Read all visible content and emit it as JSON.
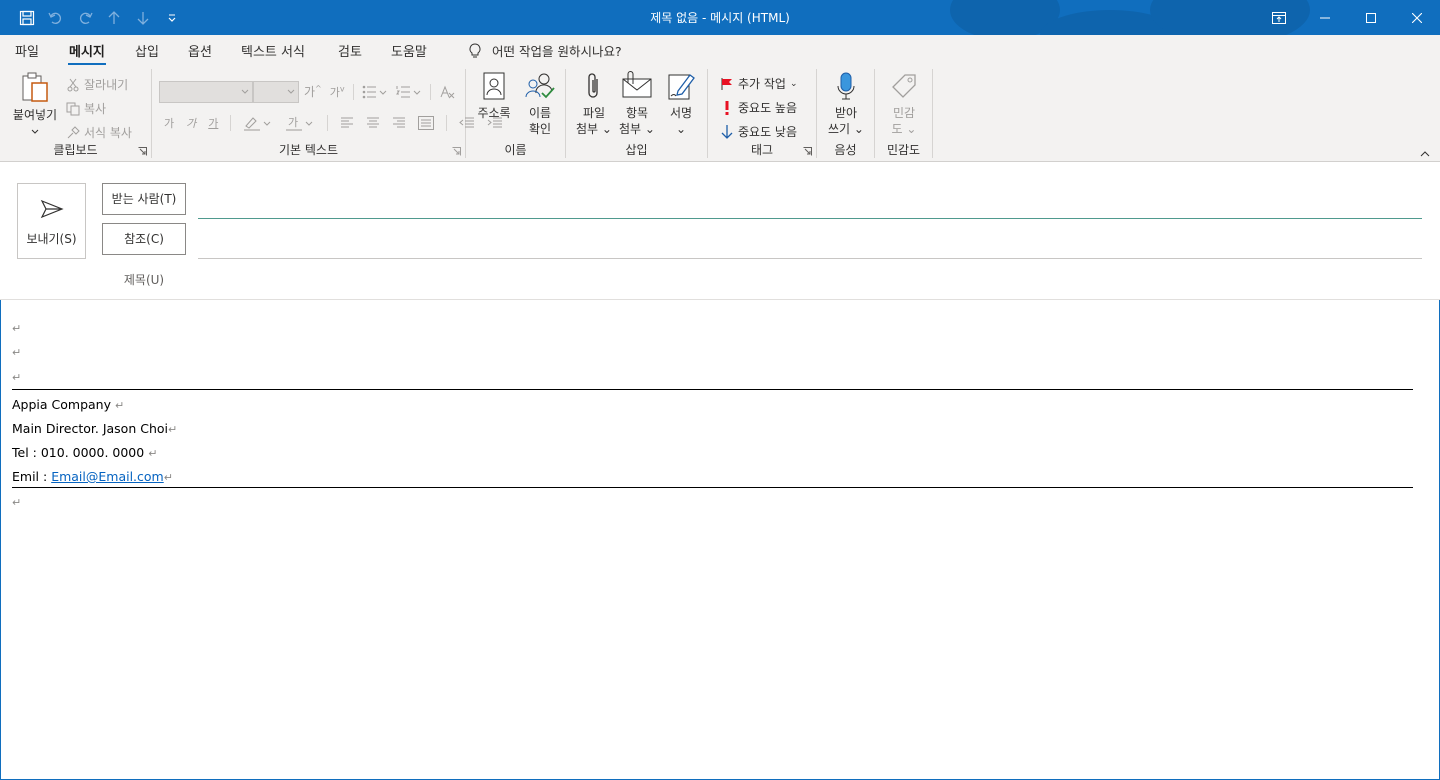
{
  "window": {
    "title": "제목 없음  -  메시지 (HTML)"
  },
  "menu": {
    "tabs": [
      "파일",
      "메시지",
      "삽입",
      "옵션",
      "텍스트 서식",
      "검토",
      "도움말"
    ],
    "active_tab": "메시지",
    "tell_me": "어떤 작업을 원하시나요?"
  },
  "ribbon": {
    "clipboard": {
      "label": "클립보드",
      "paste": "붙여넣기",
      "cut": "잘라내기",
      "copy": "복사",
      "format_painter": "서식 복사"
    },
    "basic_text": {
      "label": "기본 텍스트"
    },
    "names": {
      "label": "이름",
      "address_book": "주소록",
      "check_names_1": "이름",
      "check_names_2": "확인"
    },
    "include": {
      "label": "삽입",
      "attach_file_1": "파일",
      "attach_file_2": "첨부",
      "attach_item_1": "항목",
      "attach_item_2": "첨부",
      "signature": "서명"
    },
    "tags": {
      "label": "태그",
      "follow_up": "추가 작업",
      "high_importance": "중요도 높음",
      "low_importance": "중요도 낮음"
    },
    "voice": {
      "label": "음성",
      "dictate_1": "받아",
      "dictate_2": "쓰기"
    },
    "sensitivity": {
      "label": "민감도",
      "btn_1": "민감",
      "btn_2": "도"
    }
  },
  "compose": {
    "send": "보내기(S)",
    "to": "받는 사람(T)",
    "cc": "참조(C)",
    "subject": "제목(U)"
  },
  "signature": {
    "company": "Appia Company",
    "title": "Main Director. Jason Choi",
    "tel": "Tel : 010. 0000. 0000",
    "email_label": "Emil : ",
    "email": "Email@Email.com"
  },
  "colors": {
    "titlebar": "#106ebe",
    "ribbon": "#f3f2f1",
    "accent": "#106ebe",
    "link": "#0563c1"
  }
}
